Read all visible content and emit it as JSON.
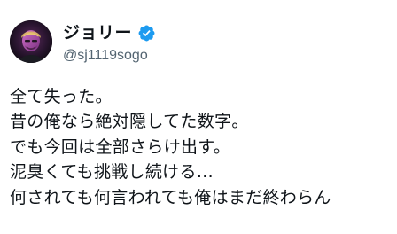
{
  "author": {
    "display_name": "ジョリー",
    "handle": "@sj1119sogo",
    "verified": true,
    "avatar_icon": "profile-photo",
    "verified_icon": "verified-badge-icon"
  },
  "tweet": {
    "lines": [
      "全て失った。",
      "昔の俺なら絶対隠してた数字。",
      "でも今回は全部さらけ出す。",
      "泥臭くても挑戦し続ける…",
      "何されても何言われても俺はまだ終わらん"
    ]
  },
  "colors": {
    "text": "#0f1419",
    "secondary_text": "#536471",
    "verified_blue": "#1d9bf0",
    "background": "#ffffff"
  }
}
